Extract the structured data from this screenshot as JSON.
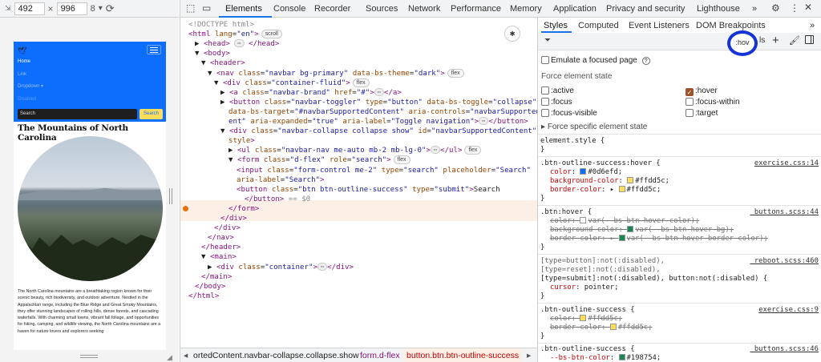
{
  "device": {
    "width": "492",
    "height": "996",
    "letter": "8"
  },
  "preview": {
    "nav_links": [
      "Home",
      "Link",
      "Dropdown ▾",
      "Disabled"
    ],
    "search_placeholder": "Search",
    "search_button": "Search",
    "title": "The Mountains of North Carolina",
    "paragraph": "The North Carolina mountains are a breathtaking region known for their scenic beauty, rich biodiversity, and outdoor adventure. Nestled in the Appalachian range, including the Blue Ridge and Great Smoky Mountains, they offer stunning landscapes of rolling hills, dense forests, and cascading waterfalls. With charming small towns, vibrant fall foliage, and opportunities for hiking, camping, and wildlife viewing, the North Carolina mountains are a haven for nature lovers and explorers seeking"
  },
  "devtools": {
    "tabs": [
      "Elements",
      "Console",
      "Recorder",
      "Sources",
      "Network",
      "Performance",
      "Memory",
      "Application",
      "Privacy and security",
      "Lighthouse"
    ],
    "more": "»",
    "dom_lines": [
      {
        "html": "<span class='cm'>&lt;!DOCTYPE html&gt;</span>"
      },
      {
        "html": "<span class='tg'>&lt;html</span> <span class='an'>lang</span>=<span class='av'>\"en\"</span><span class='tg'>&gt;</span><span class='badge'>scroll</span>"
      },
      {
        "html": "▶ <span class='tg'>&lt;head&gt;</span> <span class='ell'>⋯</span> <span class='tg'>&lt;/head&gt;</span>"
      },
      {
        "html": "▼ <span class='tg'>&lt;body&gt;</span>"
      },
      {
        "html": "▼ <span class='tg'>&lt;header&gt;</span>"
      },
      {
        "html": "▼ <span class='tg'>&lt;nav</span> <span class='an'>class</span>=<span class='av'>\"navbar bg-primary\"</span> <span class='an'>data-bs-theme</span>=<span class='av'>\"dark\"</span><span class='tg'>&gt;</span><span class='badge'>flex</span>"
      },
      {
        "html": "▼ <span class='tg'>&lt;div</span> <span class='an'>class</span>=<span class='av'>\"container-fluid\"</span><span class='tg'>&gt;</span><span class='badge'>flex</span>"
      },
      {
        "html": "▶ <span class='tg'>&lt;a</span> <span class='an'>class</span>=<span class='av'>\"navbar-brand\"</span> <span class='an'>href</span>=<span class='av'>\"#\"</span><span class='tg'>&gt;</span><span class='ell'>⋯</span><span class='tg'>&lt;/a&gt;</span>"
      },
      {
        "html": "▶ <span class='tg'>&lt;button</span> <span class='an'>class</span>=<span class='av'>\"navbar-toggler\"</span> <span class='an'>type</span>=<span class='av'>\"button\"</span> <span class='an'>data-bs-toggle</span>=<span class='av'>\"collapse\"</span>"
      },
      {
        "html": "<span class='an'>data-bs-target</span>=<span class='av'>\"#navbarSupportedContent\"</span> <span class='an'>aria-controls</span>=<span class='av'>\"navbarSupportedCont</span>"
      },
      {
        "html": "<span class='av'>ent\"</span> <span class='an'>aria-expanded</span>=<span class='av'>\"true\"</span> <span class='an'>aria-label</span>=<span class='av'>\"Toggle navigation\"</span><span class='tg'>&gt;</span><span class='ell'>⋯</span><span class='tg'>&lt;/button&gt;</span>"
      },
      {
        "html": "▼ <span class='tg'>&lt;div</span> <span class='an'>class</span>=<span class='av'>\"navbar-collapse collapse show\"</span> <span class='an'>id</span>=<span class='av'>\"navbarSupportedContent\"</span>"
      },
      {
        "html": "<span class='an'>style</span><span class='tg'>&gt;</span>"
      },
      {
        "html": "▶ <span class='tg'>&lt;ul</span> <span class='an'>class</span>=<span class='av'>\"navbar-nav me-auto mb-2 mb-lg-0\"</span><span class='tg'>&gt;</span><span class='ell'>⋯</span><span class='tg'>&lt;/ul&gt;</span><span class='badge'>flex</span>"
      },
      {
        "html": "▼ <span class='tg'>&lt;form</span> <span class='an'>class</span>=<span class='av'>\"d-flex\"</span> <span class='an'>role</span>=<span class='av'>\"search\"</span><span class='tg'>&gt;</span><span class='badge'>flex</span>"
      },
      {
        "html": "<span class='tg'>&lt;input</span> <span class='an'>class</span>=<span class='av'>\"form-control me-2\"</span> <span class='an'>type</span>=<span class='av'>\"search\"</span> <span class='an'>placeholder</span>=<span class='av'>\"Search\"</span>"
      },
      {
        "html": "<span class='an'>aria-label</span>=<span class='av'>\"Search\"</span><span class='tg'>&gt;</span>"
      },
      {
        "html": "<span class='tg'>&lt;button</span> <span class='an'>class</span>=<span class='av'>\"btn btn-outline-success\"</span> <span class='an'>type</span>=<span class='av'>\"submit\"</span><span class='tg'>&gt;</span><span class='tx'>Search</span>"
      },
      {
        "html": "<span class='tg'>&lt;/button&gt;</span> <span class='cm'>== $0</span>"
      },
      {
        "html": "<span class='tg'>&lt;/form&gt;</span>"
      },
      {
        "html": "<span class='tg'>&lt;/div&gt;</span>"
      },
      {
        "html": "<span class='tg'>&lt;/div&gt;</span>"
      },
      {
        "html": "<span class='tg'>&lt;/nav&gt;</span>"
      },
      {
        "html": "<span class='tg'>&lt;/header&gt;</span>"
      },
      {
        "html": "▼ <span class='tg'>&lt;main&gt;</span>"
      },
      {
        "html": "▶ <span class='tg'>&lt;div</span> <span class='an'>class</span>=<span class='av'>\"container\"</span><span class='tg'>&gt;</span><span class='ell'>⋯</span><span class='tg'>&lt;/div&gt;</span>"
      },
      {
        "html": "<span class='tg'>&lt;/main&gt;</span>"
      },
      {
        "html": "<span class='tg'>&lt;/body&gt;</span>"
      },
      {
        "html": "<span class='tg'>&lt;/html&gt;</span>"
      }
    ],
    "breadcrumbs": [
      "◂",
      "ortedContent.navbar-collapse.collapse.show",
      "form.d-flex",
      "button.btn.btn-outline-success",
      "▸"
    ],
    "styles_tabs": [
      "Styles",
      "Computed",
      "Event Listeners",
      "DOM Breakpoints",
      "»"
    ],
    "hov_label": ":hov",
    "cls_label": "ls",
    "emulate_focused": "Emulate a focused page",
    "force_state_title": "Force element state",
    "states_left": [
      ":active",
      ":focus",
      ":focus-visible"
    ],
    "states_right": [
      ":hover",
      ":focus-within",
      ":target"
    ],
    "hover_checked": true,
    "force_specific": "Force specific element state",
    "rules": {
      "element_style": "element.style {",
      "r1_selector": ".btn-outline-success:hover {",
      "r1_src": "exercise.css:14",
      "r1_p1": "color",
      "r1_v1": "#0d6efd;",
      "r1_p2": "background-color",
      "r1_v2": "#ffdd5c;",
      "r1_p3": "border-color",
      "r1_v3": "#ffdd5c;",
      "r2_selector": ".btn:hover {",
      "r2_src": "_buttons.scss:44",
      "r2_p1": "color",
      "r2_v1": "var(--bs-btn-hover-color);",
      "r2_p2": "background-color",
      "r2_v2": "var(--bs-btn-hover-bg);",
      "r2_p3": "border-color",
      "r2_v3": "var(--bs-btn-hover-border-color);",
      "r3_sel1": "[type=button]:not(:disabled),",
      "r3_src": "_reboot.scss:460",
      "r3_sel2": "[type=reset]:not(:disabled),",
      "r3_sel3": "[type=submit]:not(:disabled), button:not(:disabled) {",
      "r3_p1": "cursor",
      "r3_v1": "pointer;",
      "r4_selector": ".btn-outline-success {",
      "r4_src": "exercise.css:9",
      "r4_p1": "color",
      "r4_v1": "#ffdd5c;",
      "r4_p2": "border-color",
      "r4_v2": "#ffdd5c;",
      "r5_selector": ".btn-outline-success {",
      "r5_src": "_buttons.scss:46",
      "r5_p1": "--bs-btn-color",
      "r5_v1": "#198754;",
      "close_brace": "}"
    }
  },
  "colors": {
    "primary": "#0d6efd",
    "yellow": "#ffdd5c",
    "green": "#198754",
    "accent": "#1a73e8",
    "hover_ring": "#1533d6"
  }
}
